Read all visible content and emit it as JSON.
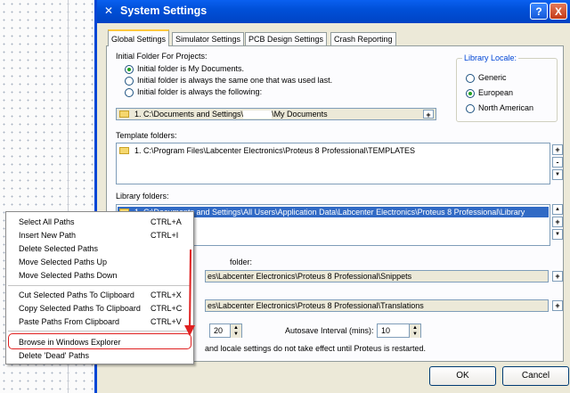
{
  "window": {
    "title": "System Settings",
    "help_label": "?",
    "close_label": "X"
  },
  "tabs": [
    "Global Settings",
    "Simulator Settings",
    "PCB Design Settings",
    "Crash Reporting"
  ],
  "initial_folder": {
    "heading": "Initial Folder For Projects:",
    "options": [
      "Initial folder is My Documents.",
      "Initial folder is always the same one that was used last.",
      "Initial folder is always the following:"
    ],
    "selected": 0,
    "path": "1.   C:\\Documents and Settings\\",
    "path_suffix": "\\My Documents"
  },
  "locale": {
    "heading": "Library Locale:",
    "options": [
      "Generic",
      "European",
      "North American"
    ],
    "selected": 1
  },
  "template": {
    "heading": "Template folders:",
    "path": "1.   C:\\Program Files\\Labcenter Electronics\\Proteus 8 Professional\\TEMPLATES"
  },
  "library": {
    "heading": "Library folders:",
    "path": "1.   C:\\Documents and Settings\\All Users\\Application Data\\Labcenter Electronics\\Proteus 8 Professional\\Library"
  },
  "snippets": {
    "heading": "folder:",
    "path": "es\\Labcenter Electronics\\Proteus 8 Professional\\Snippets"
  },
  "translations": {
    "path": "es\\Labcenter Electronics\\Proteus 8 Professional\\Translations"
  },
  "spin_value": "20",
  "autosave": {
    "label": "Autosave Interval (mins):",
    "value": "10"
  },
  "note": "and locale settings do not take effect until Proteus is restarted.",
  "buttons": {
    "ok": "OK",
    "cancel": "Cancel"
  },
  "glyphs": {
    "plus": "+",
    "minus": "-",
    "up": "▲",
    "down": "▼",
    "app": "✕"
  },
  "context_menu": {
    "items": [
      {
        "label": "Select All Paths",
        "shortcut": "CTRL+A"
      },
      {
        "label": "Insert New Path",
        "shortcut": "CTRL+I"
      },
      {
        "label": "Delete Selected Paths",
        "shortcut": ""
      },
      {
        "label": "Move Selected Paths Up",
        "shortcut": ""
      },
      {
        "label": "Move Selected Paths Down",
        "shortcut": ""
      },
      {
        "label": "Cut Selected Paths To Clipboard",
        "shortcut": "CTRL+X"
      },
      {
        "label": "Copy Selected Paths To Clipboard",
        "shortcut": "CTRL+C"
      },
      {
        "label": "Paste Paths From Clipboard",
        "shortcut": "CTRL+V"
      },
      {
        "label": "Browse in Windows Explorer",
        "shortcut": ""
      },
      {
        "label": "Delete 'Dead' Paths",
        "shortcut": ""
      }
    ]
  },
  "colors": {
    "annotation": "#e02020",
    "accent": "#0046d5"
  }
}
